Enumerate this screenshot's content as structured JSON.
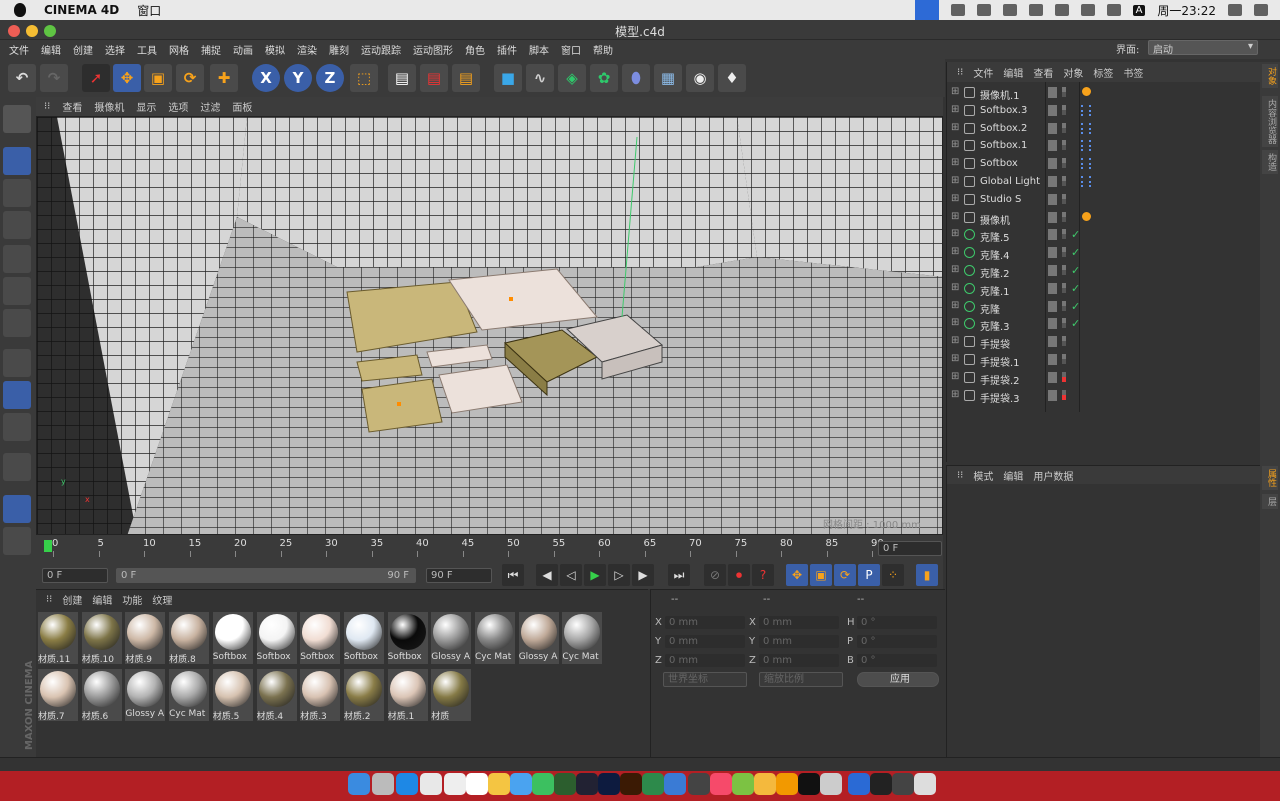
{
  "mac_menubar": {
    "app_name": "CINEMA 4D",
    "menu_window": "窗口",
    "clock": "周一23:22",
    "input_method": "A"
  },
  "window": {
    "title": "模型.c4d"
  },
  "main_menu": [
    "文件",
    "编辑",
    "创建",
    "选择",
    "工具",
    "网格",
    "捕捉",
    "动画",
    "模拟",
    "渲染",
    "雕刻",
    "运动跟踪",
    "运动图形",
    "角色",
    "插件",
    "脚本",
    "窗口",
    "帮助"
  ],
  "interface": {
    "label": "界面:",
    "value": "启动"
  },
  "viewport": {
    "menu": [
      "查看",
      "摄像机",
      "显示",
      "选项",
      "过滤",
      "面板"
    ],
    "grid_spacing": "网格间距 : 1000 mm"
  },
  "timeline": {
    "ticks": [
      "0",
      "5",
      "10",
      "15",
      "20",
      "25",
      "30",
      "35",
      "40",
      "45",
      "50",
      "55",
      "60",
      "65",
      "70",
      "75",
      "80",
      "85",
      "90"
    ],
    "current_frame": "0 F"
  },
  "transport": {
    "start_field": "0 F",
    "range_start": "0 F",
    "range_end": "90 F",
    "end_field": "90 F"
  },
  "material_panel": {
    "menu": [
      "创建",
      "编辑",
      "功能",
      "纹理"
    ],
    "materials_row1": [
      {
        "name": "材质.11",
        "color": "#8a7d45"
      },
      {
        "name": "材质.10",
        "color": "#7d7448"
      },
      {
        "name": "材质.9",
        "color": "#cdb8a6"
      },
      {
        "name": "材质.8",
        "color": "#c8b2a0"
      },
      {
        "name": "Softbox",
        "color": "#ffffff"
      },
      {
        "name": "Softbox",
        "color": "#f4f4f4"
      },
      {
        "name": "Softbox",
        "color": "#f1ddd3"
      },
      {
        "name": "Softbox",
        "color": "#dfe8f2"
      },
      {
        "name": "Softbox",
        "color": "#0a0a0a"
      },
      {
        "name": "Glossy A",
        "color": "#9a9a9a"
      },
      {
        "name": "Cyc Mat",
        "color": "#888888"
      },
      {
        "name": "Glossy A",
        "color": "#bfa998"
      },
      {
        "name": "Cyc Mat",
        "color": "#a6a6a6"
      }
    ],
    "materials_row2": [
      {
        "name": "材质.7",
        "color": "#d9c3b1"
      },
      {
        "name": "材质.6",
        "color": "#9a9a9a"
      },
      {
        "name": "Glossy A",
        "color": "#b3b3b3"
      },
      {
        "name": "Cyc Mat",
        "color": "#a9a9a9"
      },
      {
        "name": "材质.5",
        "color": "#d6c2b0"
      },
      {
        "name": "材质.4",
        "color": "#7b7250"
      },
      {
        "name": "材质.3",
        "color": "#d8c2b2"
      },
      {
        "name": "材质.2",
        "color": "#8a7d48"
      },
      {
        "name": "材质.1",
        "color": "#dbc5b6"
      },
      {
        "name": "材质",
        "color": "#857a46"
      }
    ]
  },
  "coord_panel": {
    "headers": [
      "--",
      "--",
      "--"
    ],
    "rows": [
      {
        "a": "X",
        "av": "0 mm",
        "b": "X",
        "bv": "0 mm",
        "c": "H",
        "cv": "0 °"
      },
      {
        "a": "Y",
        "av": "0 mm",
        "b": "Y",
        "bv": "0 mm",
        "c": "P",
        "cv": "0 °"
      },
      {
        "a": "Z",
        "av": "0 mm",
        "b": "Z",
        "bv": "0 mm",
        "c": "B",
        "cv": "0 °"
      }
    ],
    "world_coord": "世界坐标",
    "scale_ratio": "缩放比例",
    "apply": "应用"
  },
  "object_panel": {
    "menu": [
      "文件",
      "编辑",
      "查看",
      "对象",
      "标签",
      "书签"
    ],
    "objects": [
      {
        "name": "摄像机.1",
        "type": "camera",
        "check": "",
        "flag": "no"
      },
      {
        "name": "Softbox.3",
        "type": "null",
        "check": "",
        "flag": "dots"
      },
      {
        "name": "Softbox.2",
        "type": "null",
        "check": "",
        "flag": "dots"
      },
      {
        "name": "Softbox.1",
        "type": "null",
        "check": "",
        "flag": "dots"
      },
      {
        "name": "Softbox",
        "type": "null",
        "check": "",
        "flag": "dots"
      },
      {
        "name": "Global Light",
        "type": "null",
        "check": "",
        "flag": "dots"
      },
      {
        "name": "Studio S",
        "type": "null",
        "check": "",
        "flag": ""
      },
      {
        "name": "摄像机",
        "type": "camera",
        "check": "",
        "flag": "no"
      },
      {
        "name": "克隆.5",
        "type": "clone",
        "check": "✓",
        "flag": ""
      },
      {
        "name": "克隆.4",
        "type": "clone",
        "check": "✓",
        "flag": ""
      },
      {
        "name": "克隆.2",
        "type": "clone",
        "check": "✓",
        "flag": ""
      },
      {
        "name": "克隆.1",
        "type": "clone",
        "check": "✓",
        "flag": ""
      },
      {
        "name": "克隆",
        "type": "clone",
        "check": "✓",
        "flag": ""
      },
      {
        "name": "克隆.3",
        "type": "clone",
        "check": "✓",
        "flag": ""
      },
      {
        "name": "手提袋",
        "type": "null",
        "check": "",
        "flag": ""
      },
      {
        "name": "手提袋.1",
        "type": "null",
        "check": "",
        "flag": ""
      },
      {
        "name": "手提袋.2",
        "type": "null",
        "check": "",
        "flag": "red"
      },
      {
        "name": "手提袋.3",
        "type": "null",
        "check": "",
        "flag": "red"
      }
    ]
  },
  "attr_panel": {
    "menu": [
      "模式",
      "编辑",
      "用户数据"
    ]
  },
  "side_tabs": [
    "对象",
    "内容浏览器",
    "构造",
    "属性",
    "层"
  ],
  "brand": "MAXON CINEMA 4D"
}
